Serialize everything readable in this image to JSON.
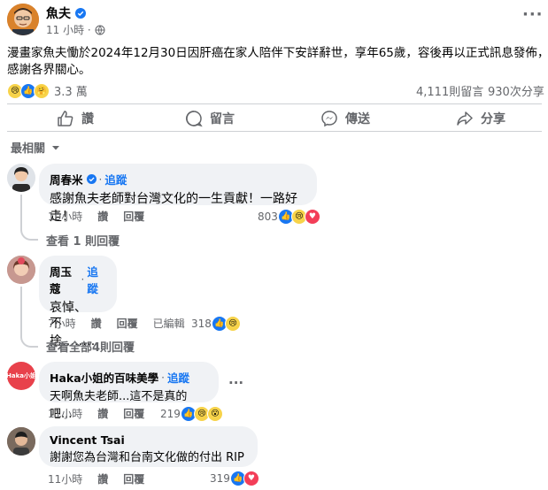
{
  "post": {
    "author": "魚夫",
    "time": "11 小時 ·",
    "text_line1": "漫畫家魚夫慟於2024年12月30日因肝癌在家人陪伴下安詳辭世，享年65歲，容後再以正式訊息發佈，",
    "text_line2": "感謝各界關心。",
    "reaction_count": "3.3 萬",
    "comment_count": "4,111則留言",
    "share_count": "930次分享",
    "more": "···"
  },
  "actions": {
    "like": "讚",
    "comment": "留言",
    "send": "傳送",
    "share": "分享"
  },
  "sort_label": "最相關",
  "comments": [
    {
      "name": "周春米",
      "follow": "追蹤",
      "text": "感謝魚夫老師對台灣文化的一生貢獻！一路好走！",
      "time": "10小時",
      "like": "讚",
      "reply": "回覆",
      "count": "803",
      "view_replies": "查看 1 則回覆"
    },
    {
      "name": "周玉蔻",
      "follow": "追蹤",
      "text_line1": "哀悼、",
      "text_line2": "不捨………",
      "time": "7小時",
      "like": "讚",
      "reply": "回覆",
      "edited": "已編輯",
      "count": "318",
      "view_replies": "查看全部4則回覆"
    },
    {
      "name": "Haka小姐的百味美學",
      "follow": "追蹤",
      "text": "天啊魚夫老師...這不是真的吧...",
      "time": "11小時",
      "like": "讚",
      "reply": "回覆",
      "count": "219",
      "more": "···",
      "avatar_text": "Haka小姐"
    },
    {
      "name": "Vincent Tsai",
      "text": "謝謝您為台灣和台南文化做的付出 RIP",
      "time": "11小時",
      "like": "讚",
      "reply": "回覆",
      "count": "319"
    }
  ],
  "colors": {
    "accent": "#1877f2",
    "bubble": "#f0f2f5",
    "muted": "#65676b",
    "haka": "#e8414b"
  }
}
